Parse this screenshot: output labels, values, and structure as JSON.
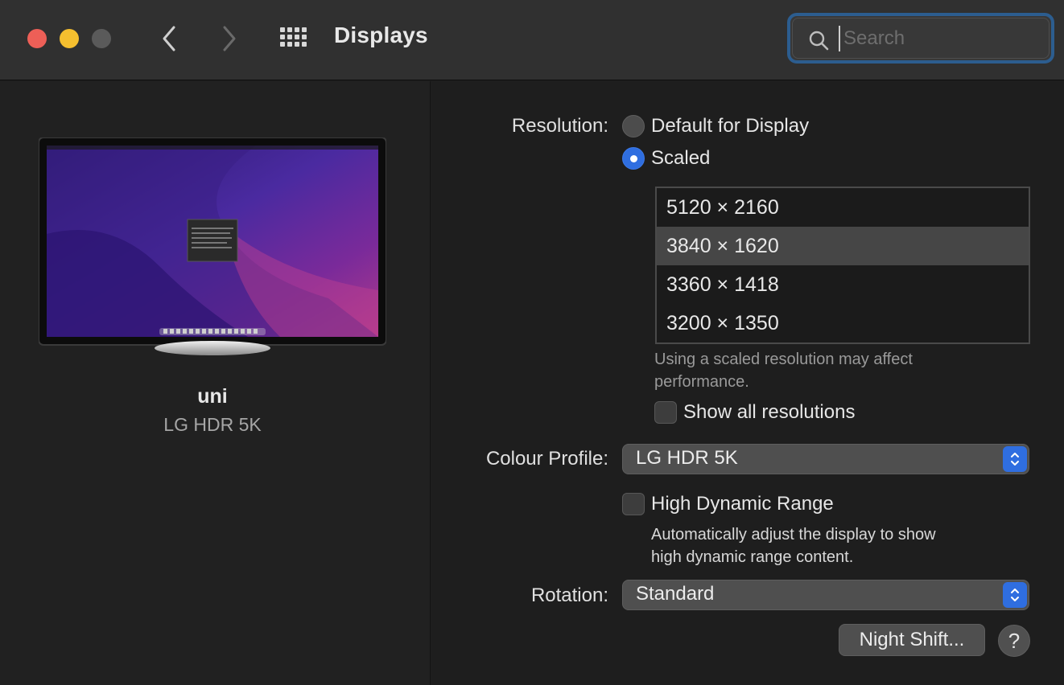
{
  "window": {
    "title": "Displays",
    "search_placeholder": "Search"
  },
  "display": {
    "name": "uni",
    "model": "LG HDR 5K"
  },
  "resolution": {
    "label": "Resolution:",
    "options": [
      "Default for Display",
      "Scaled"
    ],
    "selected_option": "Scaled",
    "scaled_list": [
      "5120 × 2160",
      "3840 × 1620",
      "3360 × 1418",
      "3200 × 1350"
    ],
    "selected_resolution": "3840 × 1620",
    "note_line1": "Using a scaled resolution may affect",
    "note_line2": "performance.",
    "show_all_label": "Show all resolutions",
    "show_all_checked": false
  },
  "colour_profile": {
    "label": "Colour Profile:",
    "value": "LG HDR 5K"
  },
  "hdr": {
    "label": "High Dynamic Range",
    "checked": false,
    "description_line1": "Automatically adjust the display to show",
    "description_line2": "high dynamic range content."
  },
  "rotation": {
    "label": "Rotation:",
    "value": "Standard"
  },
  "buttons": {
    "night_shift": "Night Shift...",
    "help": "?"
  },
  "colors": {
    "accent": "#2f6ee0",
    "focus_ring": "#2c5d8f",
    "close": "#ed5f57",
    "minimize": "#f5bf2f",
    "zoom_disabled": "#5a5a5a"
  },
  "icons": {
    "back": "chevron-left-icon",
    "forward": "chevron-right-icon",
    "show_all": "grid-icon",
    "search": "search-icon",
    "popup": "up-down-chevron-icon"
  }
}
